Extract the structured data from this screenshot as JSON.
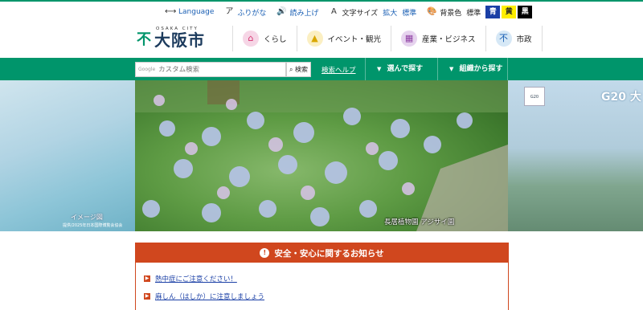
{
  "topbar": {
    "language": "Language",
    "furigana": "ふりがな",
    "read_aloud": "読み上げ",
    "text_size_label": "文字サイズ",
    "text_size_enlarge": "拡大",
    "text_size_standard": "標準",
    "bg_color_label": "背景色",
    "bg_color_standard": "標準",
    "colors": {
      "blue": "青",
      "yellow": "黄",
      "black": "黒"
    }
  },
  "header": {
    "logo_small": "OSAKA CITY",
    "logo_text": "大阪市",
    "nav": [
      {
        "label": "くらし",
        "icon": "home-icon"
      },
      {
        "label": "イベント・観光",
        "icon": "event-icon"
      },
      {
        "label": "産業・ビジネス",
        "icon": "building-icon"
      },
      {
        "label": "市政",
        "icon": "cityhall-icon"
      }
    ]
  },
  "search": {
    "google_label": "Google",
    "placeholder": "カスタム検索",
    "button": "検索",
    "help": "検索ヘルプ",
    "browse_choose": "選んで探す",
    "browse_org": "組織から探す"
  },
  "hero": {
    "caption": "長居植物園 アジサイ園",
    "left_caption": "イメージ図",
    "left_sub": "提供/2025年日本国際博覧会協会",
    "right_title": "G20 大"
  },
  "notice": {
    "title": "安全・安心に関するお知らせ",
    "items": [
      "熱中症にご注意ください！",
      "麻しん（はしか）に注意しましょう"
    ]
  },
  "colors": {
    "brand_green": "#00956b",
    "notice_red": "#d0471e"
  }
}
